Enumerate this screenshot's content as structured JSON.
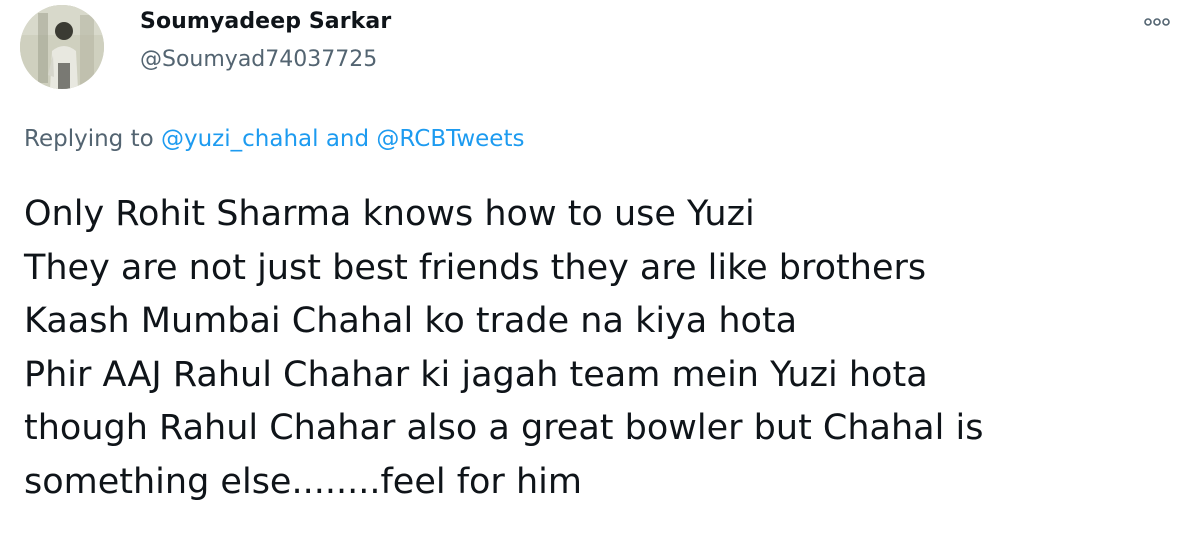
{
  "author": {
    "display_name": "Soumyadeep Sarkar",
    "handle": "@Soumyad74037725"
  },
  "menu": {
    "icon": "more-options-icon"
  },
  "reply_context": {
    "prefix": "Replying to ",
    "mention_1": "@yuzi_chahal",
    "conjunction": " and ",
    "mention_2": "@RCBTweets"
  },
  "tweet_text": {
    "lines": [
      "Only Rohit Sharma knows how to use Yuzi",
      "They are not just best friends they are like brothers",
      "Kaash Mumbai Chahal ko trade na kiya hota",
      "Phir AAJ Rahul Chahar ki jagah team mein Yuzi hota",
      "though Rahul Chahar also a great bowler but Chahal is",
      "something else........feel for him"
    ]
  },
  "colors": {
    "text": "#0f1419",
    "secondary": "#536471",
    "link": "#1d9bf0"
  }
}
